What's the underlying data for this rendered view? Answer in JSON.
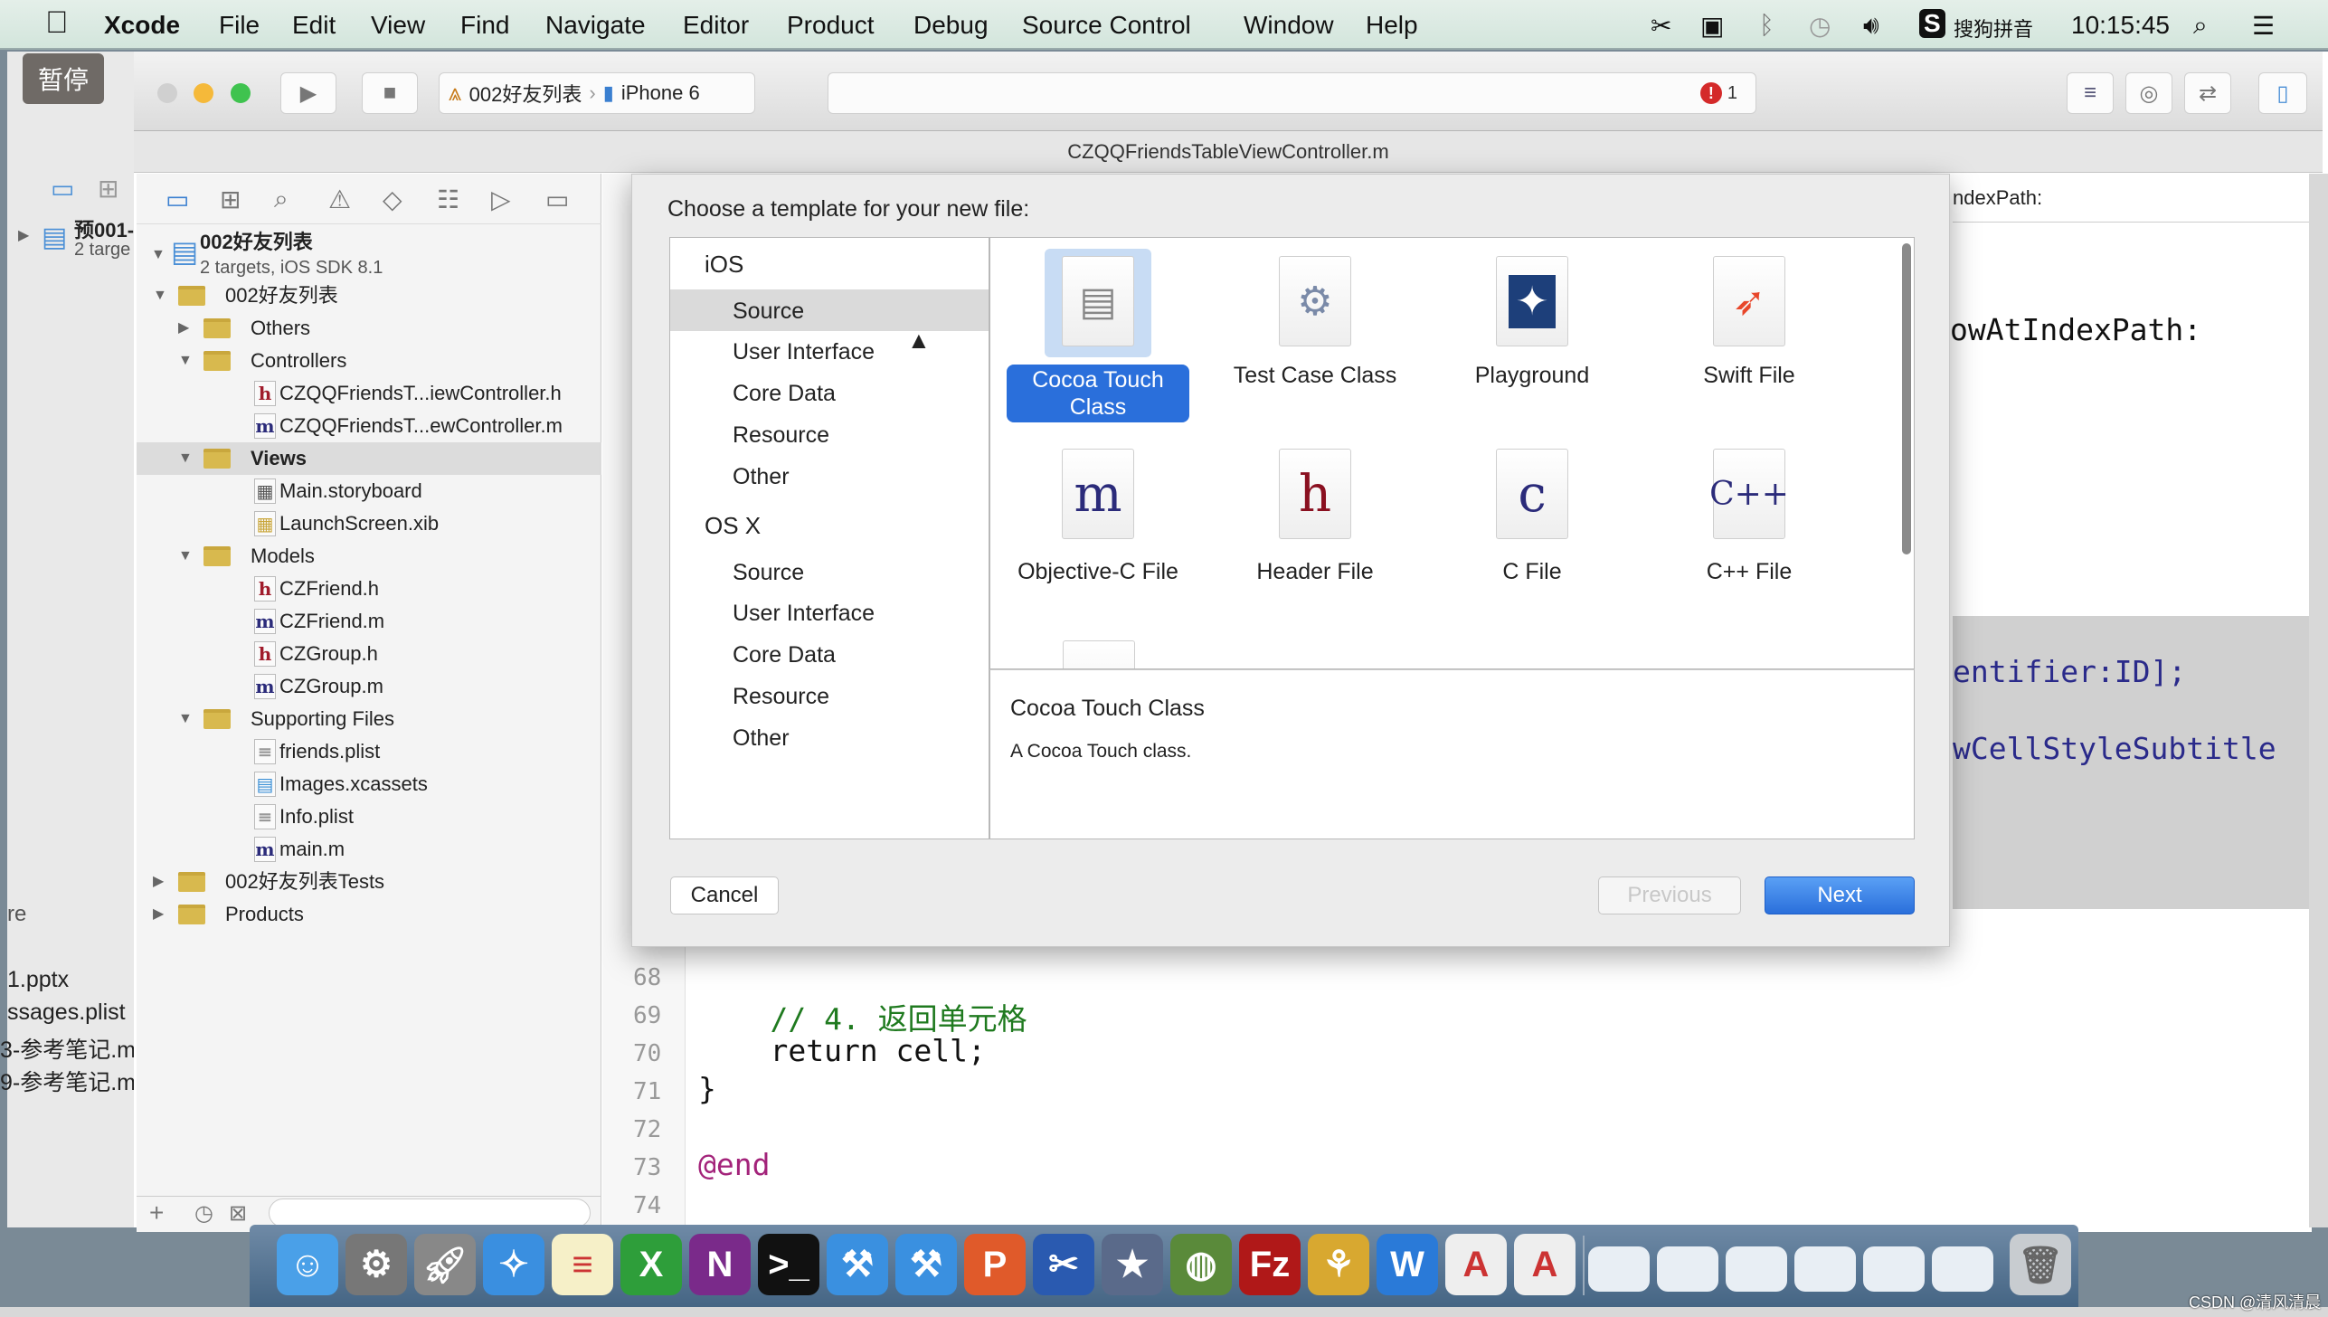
{
  "menubar": {
    "app": "Xcode",
    "items": [
      "File",
      "Edit",
      "View",
      "Find",
      "Navigate",
      "Editor",
      "Product",
      "Debug",
      "Source Control",
      "Window",
      "Help"
    ],
    "input_method": "搜狗拼音",
    "clock": "10:15:45",
    "status_icons": [
      "scissors-icon",
      "camera-icon",
      "bluetooth-icon",
      "time-machine-icon",
      "volume-icon",
      "sogou-icon"
    ]
  },
  "overlay": {
    "pause_label": "暂停"
  },
  "background_window": {
    "project_name": "预001-",
    "project_sub": "2 targe",
    "filter_text": "re",
    "files": [
      "1.pptx",
      "ssages.plist",
      "3-参考笔记.m",
      "9-参考笔记.m"
    ]
  },
  "toolbar": {
    "scheme": "002好友列表",
    "device": "iPhone 6",
    "error_count": "1"
  },
  "editor_title": "CZQQFriendsTableViewController.m",
  "navigator": {
    "project": {
      "name": "002好友列表",
      "subtitle": "2 targets, iOS SDK 8.1"
    },
    "tree": [
      {
        "label": "002好友列表",
        "depth": 1,
        "type": "folder",
        "open": true
      },
      {
        "label": "Others",
        "depth": 2,
        "type": "folder",
        "open": false
      },
      {
        "label": "Controllers",
        "depth": 2,
        "type": "folder",
        "open": true
      },
      {
        "label": "CZQQFriendsT...iewController.h",
        "depth": 3,
        "type": "h"
      },
      {
        "label": "CZQQFriendsT...ewController.m",
        "depth": 3,
        "type": "m"
      },
      {
        "label": "Views",
        "depth": 2,
        "type": "folder",
        "open": true,
        "selected": true
      },
      {
        "label": "Main.storyboard",
        "depth": 3,
        "type": "storyboard"
      },
      {
        "label": "LaunchScreen.xib",
        "depth": 3,
        "type": "xib"
      },
      {
        "label": "Models",
        "depth": 2,
        "type": "folder",
        "open": true
      },
      {
        "label": "CZFriend.h",
        "depth": 3,
        "type": "h"
      },
      {
        "label": "CZFriend.m",
        "depth": 3,
        "type": "m"
      },
      {
        "label": "CZGroup.h",
        "depth": 3,
        "type": "h"
      },
      {
        "label": "CZGroup.m",
        "depth": 3,
        "type": "m"
      },
      {
        "label": "Supporting Files",
        "depth": 2,
        "type": "folder",
        "open": true
      },
      {
        "label": "friends.plist",
        "depth": 3,
        "type": "plist"
      },
      {
        "label": "Images.xcassets",
        "depth": 3,
        "type": "xcassets"
      },
      {
        "label": "Info.plist",
        "depth": 3,
        "type": "plist"
      },
      {
        "label": "main.m",
        "depth": 3,
        "type": "m"
      },
      {
        "label": "002好友列表Tests",
        "depth": 1,
        "type": "folder",
        "open": false
      },
      {
        "label": "Products",
        "depth": 1,
        "type": "folder",
        "open": false
      }
    ]
  },
  "code": {
    "jump_bar_fragment": "ndexPath:",
    "fragments": [
      "owAtIndexPath:",
      "entifier:ID];",
      "wCellStyleSubtitle"
    ],
    "lines": [
      {
        "n": "68",
        "text": ""
      },
      {
        "n": "69",
        "text": "    // 4. 返回单元格",
        "kind": "comment"
      },
      {
        "n": "70",
        "text": "    return cell;",
        "kind": "return"
      },
      {
        "n": "71",
        "text": "}"
      },
      {
        "n": "72",
        "text": ""
      },
      {
        "n": "73",
        "text": "@end",
        "kind": "keyword"
      },
      {
        "n": "74",
        "text": ""
      }
    ]
  },
  "sheet": {
    "prompt": "Choose a template for your new file:",
    "sections": [
      {
        "name": "iOS",
        "items": [
          "Source",
          "User Interface",
          "Core Data",
          "Resource",
          "Other"
        ],
        "selected": "Source"
      },
      {
        "name": "OS X",
        "items": [
          "Source",
          "User Interface",
          "Core Data",
          "Resource",
          "Other"
        ]
      }
    ],
    "templates": [
      {
        "label": "Cocoa Touch Class",
        "glyph": "",
        "selected": true
      },
      {
        "label": "Test Case Class",
        "glyph": ""
      },
      {
        "label": "Playground",
        "glyph": ""
      },
      {
        "label": "Swift File",
        "glyph": ""
      },
      {
        "label": "Objective-C File",
        "glyph": "m"
      },
      {
        "label": "Header File",
        "glyph": "h"
      },
      {
        "label": "C File",
        "glyph": "c"
      },
      {
        "label": "C++ File",
        "glyph": "C++"
      }
    ],
    "description_title": "Cocoa Touch Class",
    "description_text": "A Cocoa Touch class.",
    "cancel": "Cancel",
    "previous": "Previous",
    "next": "Next",
    "accent": "#2a6fdb"
  },
  "dock": {
    "apps": [
      "Finder",
      "System Preferences",
      "Launchpad",
      "Safari",
      "Notes",
      "Excel",
      "OneNote",
      "Terminal",
      "Xcode",
      "Xcode Helper",
      "PowerPoint",
      "Screenshot",
      "iMovie",
      "Network Utility",
      "FileZilla",
      "Instruments",
      "Word",
      "Document",
      "Document"
    ],
    "windows": 6
  },
  "watermark": "CSDN @清风清晨"
}
